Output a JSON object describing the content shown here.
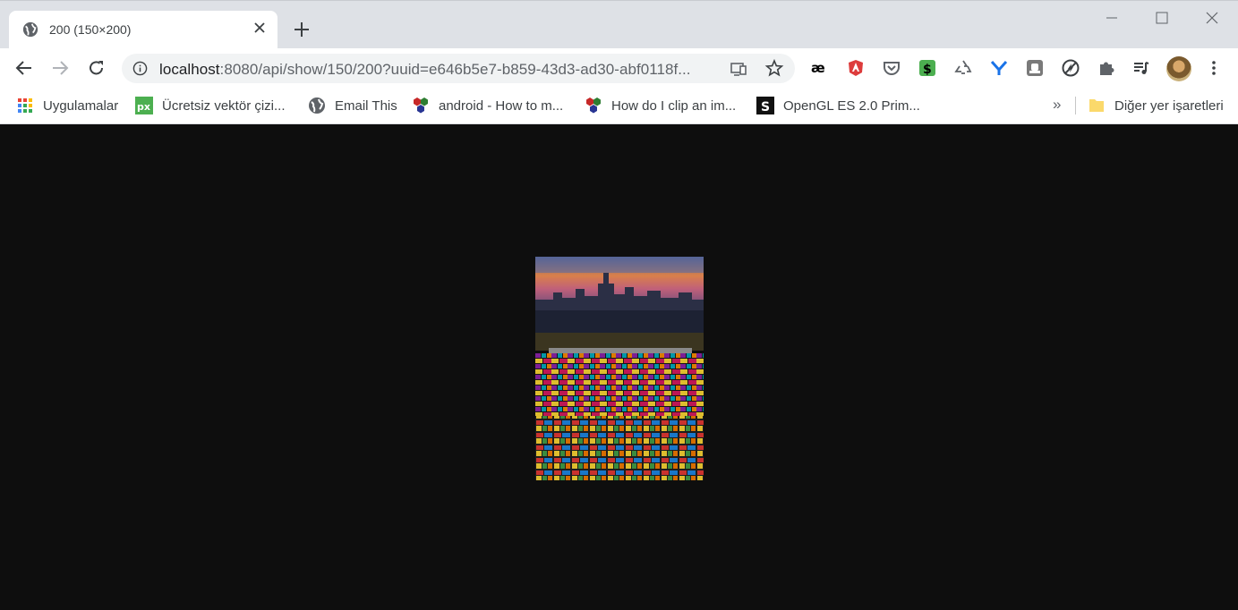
{
  "tab": {
    "title": "200 (150×200)",
    "favicon": "globe-icon",
    "close_icon": "close-icon"
  },
  "newtab": {
    "icon": "plus-icon"
  },
  "window_controls": [
    "minimize-icon",
    "maximize-icon",
    "close-icon"
  ],
  "toolbar": {
    "back_icon": "arrow-left-icon",
    "forward_icon": "arrow-right-icon",
    "reload_icon": "reload-icon",
    "url_host": "localhost",
    "url_rest": ":8080/api/show/150/200?uuid=e646b5e7-b859-43d3-ad30-abf0118f...",
    "info_icon": "info-icon",
    "cast_icon": "cast-icon",
    "bookmark_icon": "star-icon",
    "extensions": [
      "ae-extension-icon",
      "angular-extension-icon",
      "pocket-extension-icon",
      "dollar-extension-icon",
      "recycle-extension-icon",
      "y-extension-icon",
      "square-extension-icon",
      "no-sign-extension-icon",
      "puzzle-icon",
      "media-playlist-icon"
    ],
    "menu_icon": "kebab-menu-icon"
  },
  "bookmarks": {
    "items": [
      {
        "label": "Uygulamalar",
        "icon": "apps-grid-icon"
      },
      {
        "label": "Ücretsiz vektör çizi...",
        "icon": "px-icon"
      },
      {
        "label": "Email This",
        "icon": "globe-icon"
      },
      {
        "label": "android - How to m...",
        "icon": "stack-icon"
      },
      {
        "label": "How do I clip an im...",
        "icon": "stack-icon"
      },
      {
        "label": "OpenGL ES 2.0 Prim...",
        "icon": "s-icon"
      }
    ],
    "overflow": "»",
    "other_label": "Diğer yer işaretleri",
    "other_icon": "folder-icon"
  },
  "content": {
    "image_description_icon": "city-market-photo"
  }
}
